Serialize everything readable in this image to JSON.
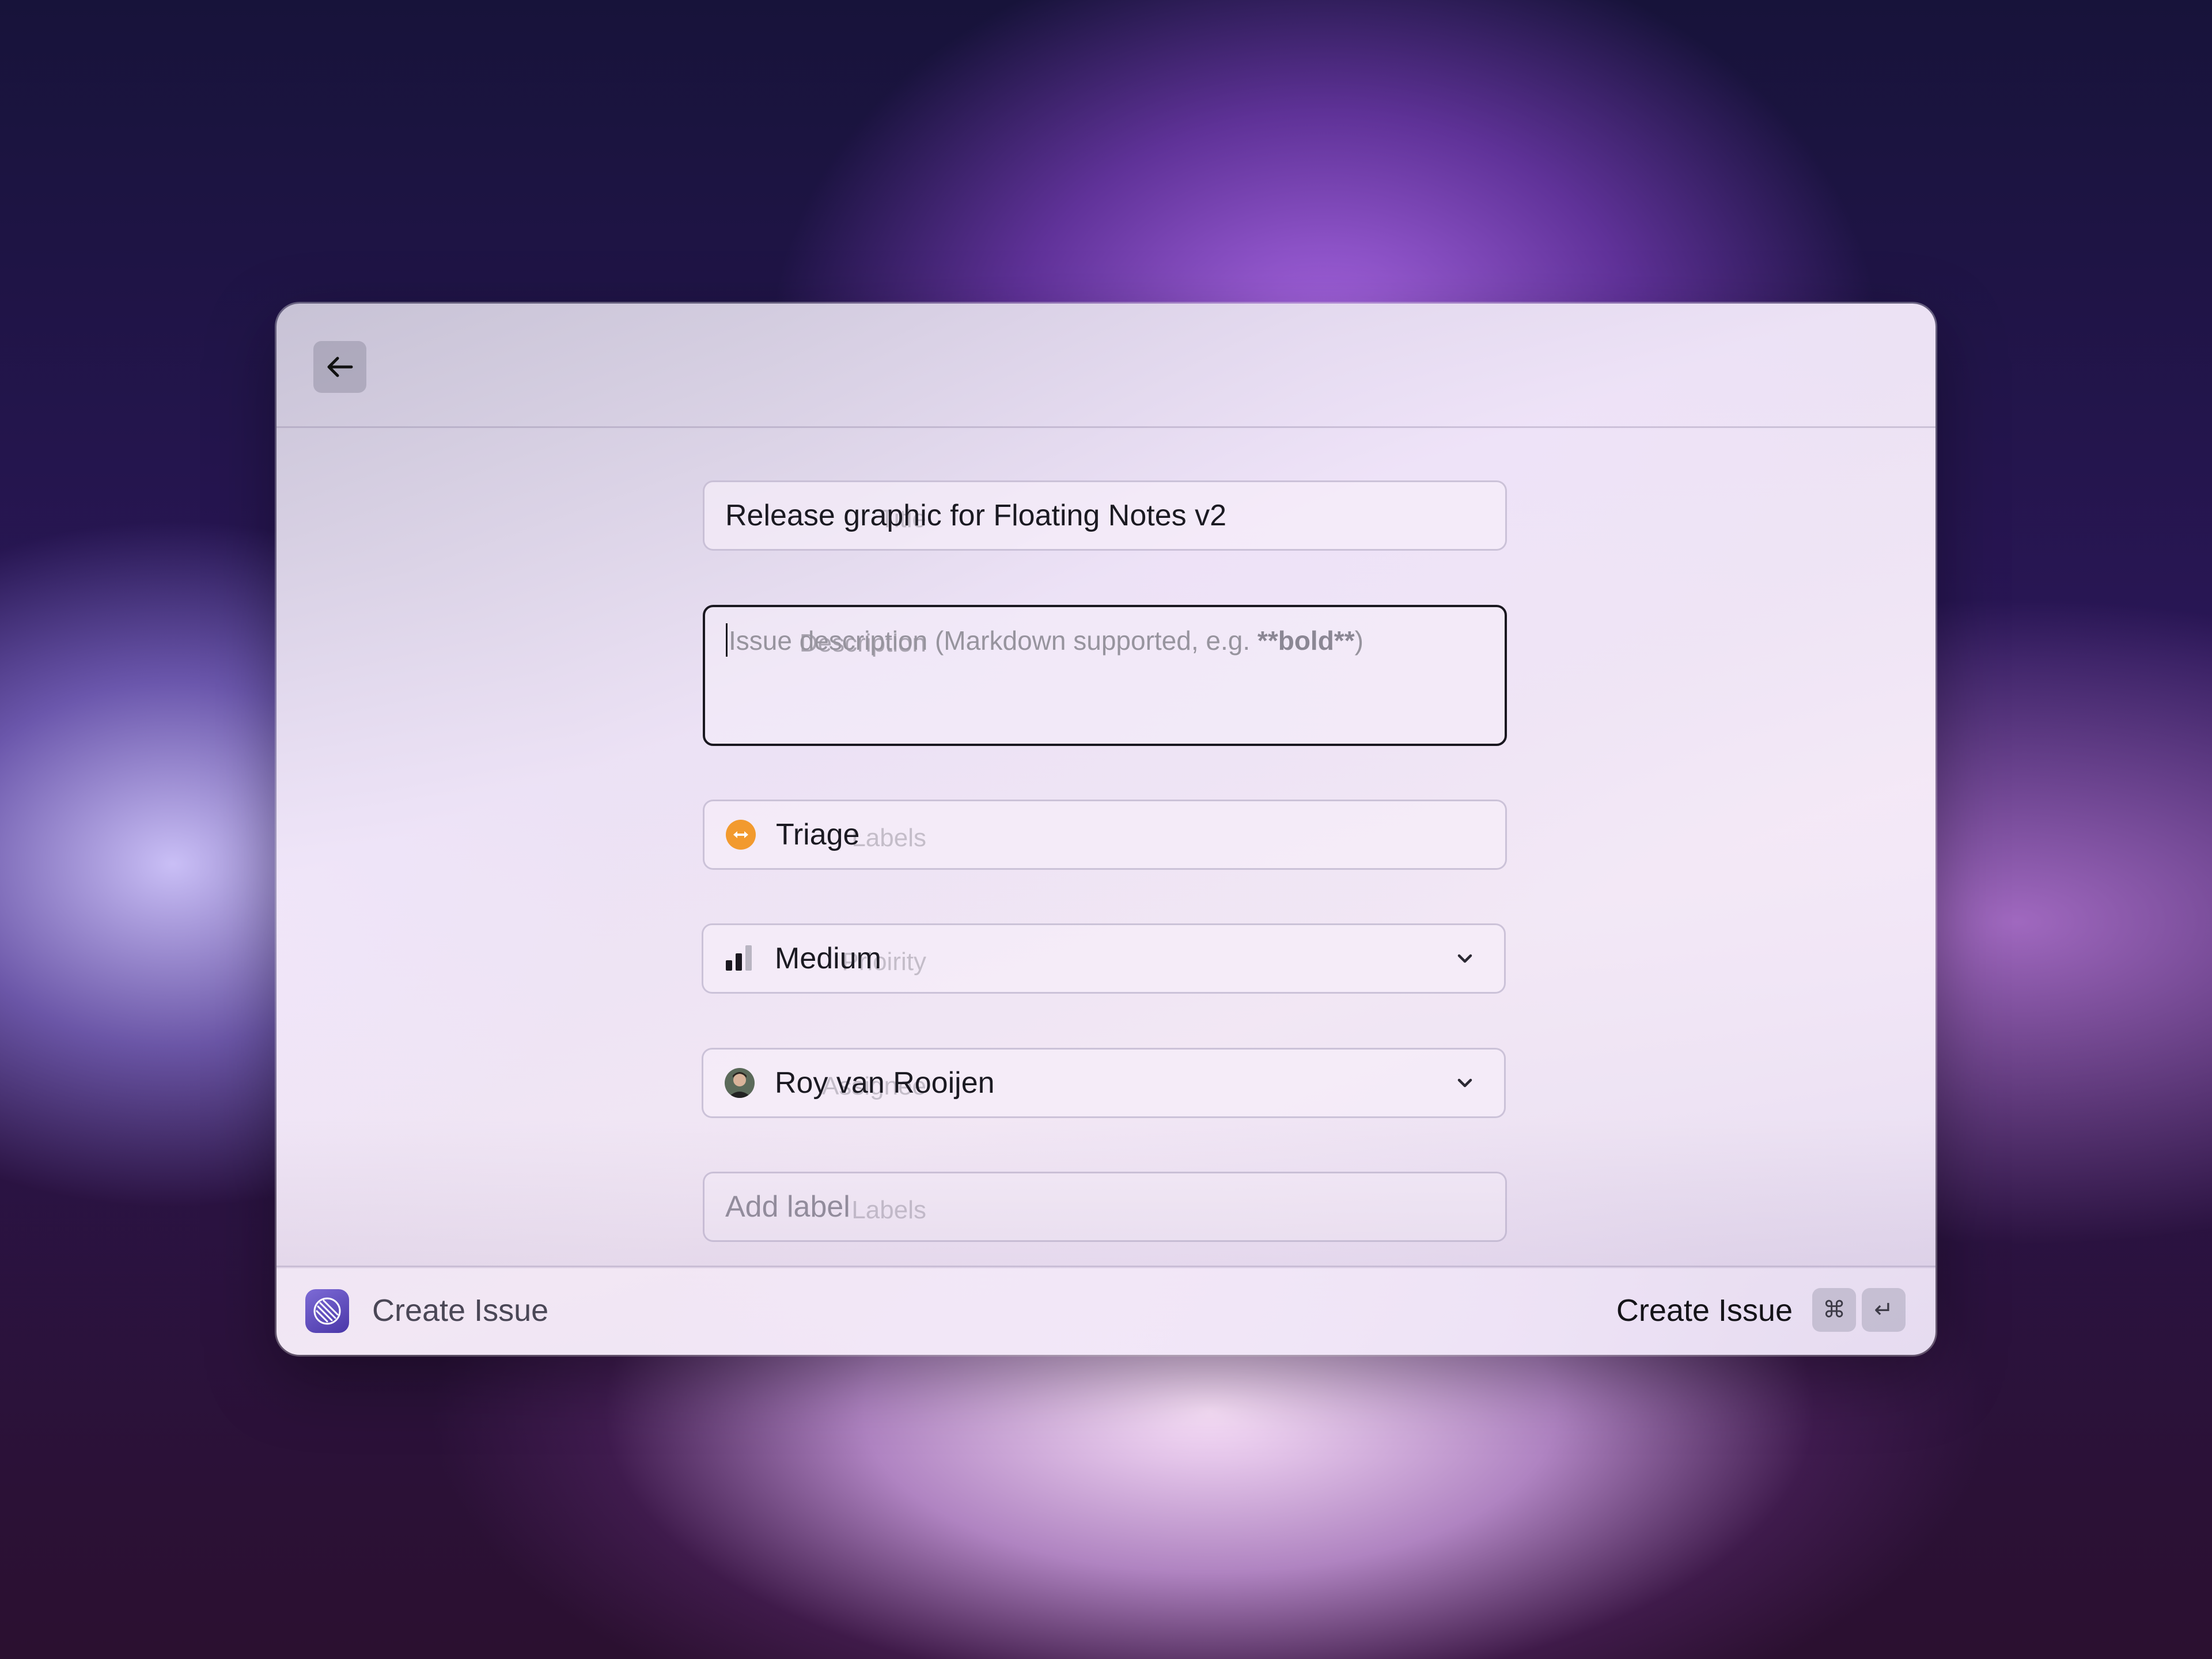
{
  "window": {
    "back_icon": "arrow-left-icon"
  },
  "form": {
    "title": {
      "label": "Title",
      "value": "Release graphic for Floating Notes v2"
    },
    "description": {
      "label": "Description",
      "placeholder_prefix": "Issue description (Markdown supported, e.g. ",
      "placeholder_bold": "**bold**",
      "placeholder_suffix": ")"
    },
    "labels_1": {
      "label": "Labels",
      "value": "Triage",
      "icon": "triage-icon",
      "icon_color": "#F29A2E"
    },
    "priority": {
      "label": "Prioirity",
      "value": "Medium",
      "icon": "priority-bars-icon"
    },
    "assignee": {
      "label": "Assignee",
      "value": "Roy van Rooijen",
      "icon": "avatar"
    },
    "labels_2": {
      "label": "Labels",
      "placeholder": "Add label"
    }
  },
  "footer": {
    "app_name": "Create Issue",
    "action_label": "Create Issue",
    "shortcut_keys": [
      "⌘",
      "↵"
    ]
  },
  "colors": {
    "accent": "#5B47BF",
    "triage": "#F29A2E"
  }
}
